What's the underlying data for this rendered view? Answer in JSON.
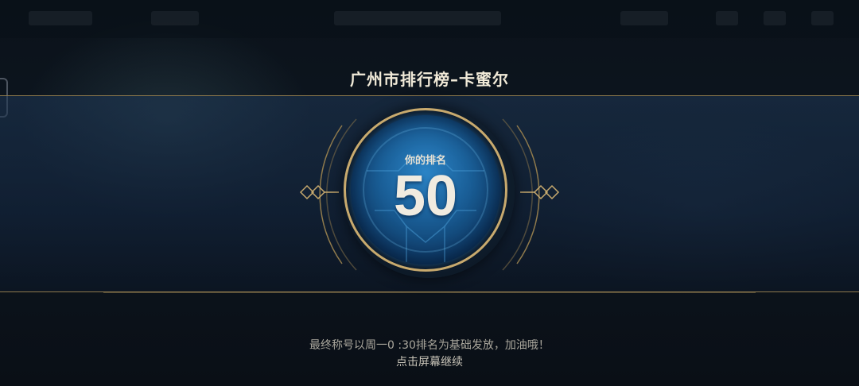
{
  "leaderboard": {
    "title": "广州市排行榜–卡蜜尔",
    "rank_label": "你的排名",
    "rank_value": "50"
  },
  "footer": {
    "note": "最终称号以周一0 :30排名为基础发放，加油哦！",
    "continue_hint": "点击屏幕继续"
  },
  "side_id": "2019931",
  "colors": {
    "gold": "#c8aa6e",
    "orb_blue": "#1a5f98",
    "band": "#1e3755"
  }
}
